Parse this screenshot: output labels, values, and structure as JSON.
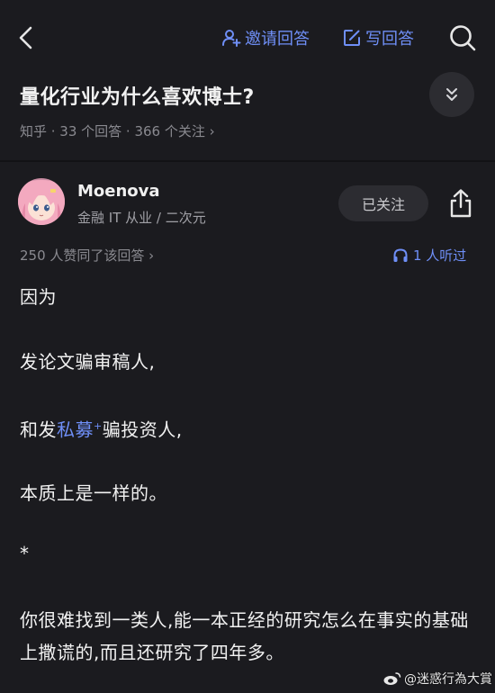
{
  "header": {
    "invite_label": "邀请回答",
    "write_label": "写回答"
  },
  "question": {
    "title": "量化行业为什么喜欢博士?",
    "meta": "知乎 · 33 个回答 · 366 个关注 ›"
  },
  "author": {
    "name": "Moenova",
    "description": "金融 IT 从业 / 二次元",
    "follow_label": "已关注"
  },
  "answer": {
    "votes": "250 人赞同了该回答 ›",
    "listen": "1 人听过",
    "p1": "因为",
    "p2": "发论文骗审稿人,",
    "p3_prefix": "和发",
    "p3_link": "私募",
    "p3_spark": "+",
    "p3_suffix": "骗投资人,",
    "p4": "本质上是一样的。",
    "p5": "*",
    "p6": "你很难找到一类人,能一本正经的研究怎么在事实的基础上撒谎的,而且还研究了四年多。"
  },
  "watermark": "@迷惑行為大賞",
  "icons": {
    "back": "chevron-left-icon",
    "invite": "user-plus-icon",
    "write": "edit-icon",
    "search": "search-icon",
    "collapse": "double-chevron-down-icon",
    "share": "share-icon",
    "listen": "headphones-icon",
    "watermark": "weibo-icon"
  },
  "colors": {
    "background": "#1b1b1f",
    "accent": "#6f8ff7",
    "text": "#f2f2f2",
    "muted": "#8a8a90"
  }
}
